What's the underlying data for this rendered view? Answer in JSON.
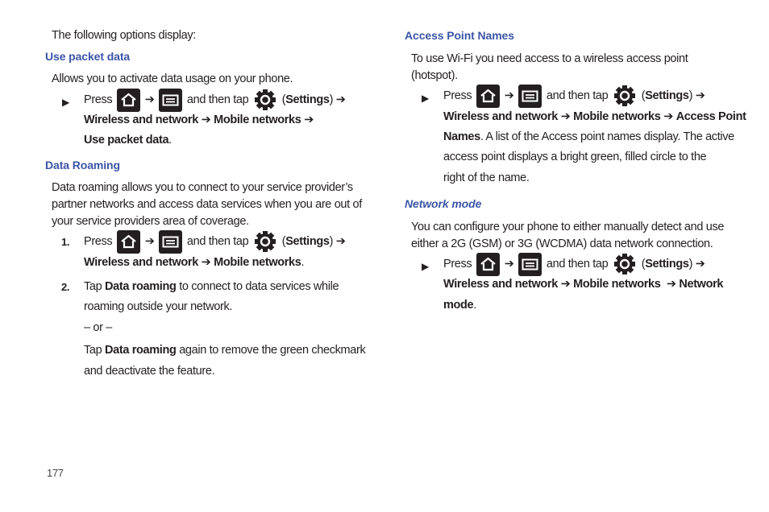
{
  "page_number": "177",
  "icons": {
    "home": "home-key-icon",
    "menu": "menu-key-icon",
    "settings": "settings-gear-icon"
  },
  "colors": {
    "heading": "#3b55a6",
    "text": "#231f20"
  },
  "common": {
    "press": "Press",
    "arrow": "➔",
    "and_then_tap": "and then tap",
    "settings_open": "(",
    "settings": "Settings",
    "settings_close": ")",
    "wireless": "Wireless and network",
    "mobile": "Mobile networks",
    "bullet": "▶"
  },
  "left": {
    "intro": "The following options display:",
    "packet": {
      "heading": "Use packet data",
      "desc": "Allows you to activate data usage on your phone.",
      "final": "Use packet data",
      "period": "."
    },
    "roaming": {
      "heading": "Data Roaming",
      "desc_lines": [
        "Data roaming allows you to connect to your service provider’s",
        "partner networks and access data services when you are out of",
        "your service providers area of coverage."
      ],
      "step1_num": "1.",
      "period": ".",
      "step2_num": "2.",
      "step2_a": "Tap",
      "step2_bold": "Data roaming",
      "step2_b": "to connect to data services while",
      "step2_line2": "roaming outside your network.",
      "or": "– or –",
      "alt_a": "Tap",
      "alt_bold": "Data roaming",
      "alt_b": "again to remove the green checkmark",
      "alt_line2": "and deactivate the feature."
    }
  },
  "right": {
    "apn": {
      "heading": "Access Point Names",
      "desc_lines": [
        "To use Wi-Fi you need access to a wireless access point",
        "(hotspot)."
      ],
      "final_a": "Access Point",
      "final_b": "Names",
      "tail1": ". A list of the Access point names display. The active",
      "tail2": "access point displays a bright green, filled circle to the",
      "tail3": "right of the name."
    },
    "network_mode": {
      "heading": "Network mode",
      "desc_lines": [
        "You can configure your phone to either manually detect and use",
        "either a 2G (GSM) or 3G (WCDMA) data network connection."
      ],
      "final_a": "Network",
      "final_b": "mode",
      "period": "."
    }
  }
}
